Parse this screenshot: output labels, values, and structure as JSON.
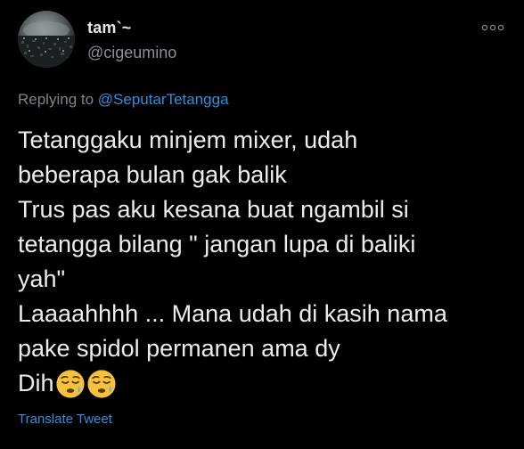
{
  "tweet": {
    "display_name": "tam`~",
    "handle": "@cigeumino",
    "more_icon": "more-options-icon",
    "replying_prefix": "Replying to",
    "replying_to": "@SeputarTetangga",
    "body_lines": [
      "Tetanggaku minjem mixer, udah",
      "beberapa bulan gak balik",
      "Trus pas aku kesana buat ngambil si",
      "tetangga bilang \" jangan lupa di baliki",
      "yah\"",
      "Laaaahhhh ... Mana udah di kasih nama",
      "pake spidol permanen ama dy",
      "Dih"
    ],
    "emojis": [
      "sleepy-face-emoji",
      "sleepy-face-emoji"
    ],
    "translate_label": "Translate Tweet"
  },
  "colors": {
    "background": "#000000",
    "text": "#ececec",
    "muted": "#8b9097",
    "link": "#2d8fe0"
  }
}
